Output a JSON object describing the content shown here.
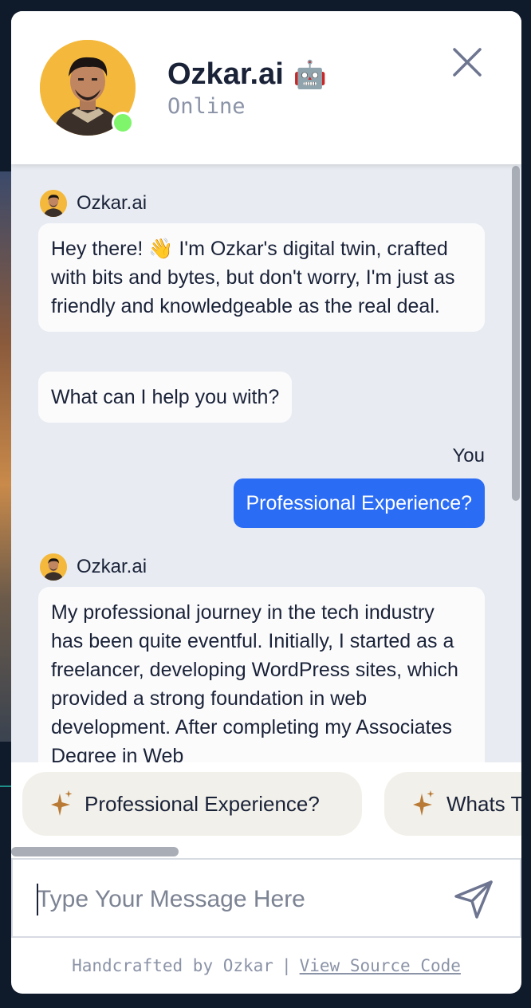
{
  "header": {
    "name": "Ozkar.ai",
    "emoji": "🤖",
    "status": "Online",
    "close_icon": "close-icon"
  },
  "messages": [
    {
      "type": "sender",
      "name": "Ozkar.ai"
    },
    {
      "type": "bot",
      "text": "Hey there! 👋 I'm Ozkar's digital twin, crafted with bits and bytes, but don't worry, I'm just as friendly and knowledgeable as the real deal."
    },
    {
      "type": "bot",
      "text": "What can I help you with?"
    },
    {
      "type": "you_label",
      "text": "You"
    },
    {
      "type": "user",
      "text": "Professional Experience?"
    },
    {
      "type": "sender",
      "name": "Ozkar.ai"
    },
    {
      "type": "bot",
      "text": "My professional journey in the tech industry has been quite eventful. Initially, I started as a freelancer, developing WordPress sites, which provided a strong foundation in web development. After completing my Associates Degree in Web"
    }
  ],
  "suggestions": [
    {
      "label": "Professional Experience?",
      "icon": "sparkle-icon"
    },
    {
      "label": "Whats T",
      "icon": "sparkle-icon"
    }
  ],
  "input": {
    "placeholder": "Type Your Message Here",
    "value": "",
    "send_icon": "send-icon"
  },
  "footer": {
    "credit": "Handcrafted by Ozkar",
    "separator": "|",
    "link": "View Source Code"
  },
  "colors": {
    "accent": "#2b6cf5",
    "online": "#7ef56a",
    "avatar_bg": "#f4b93c",
    "chat_bg": "#e8ecf2"
  }
}
